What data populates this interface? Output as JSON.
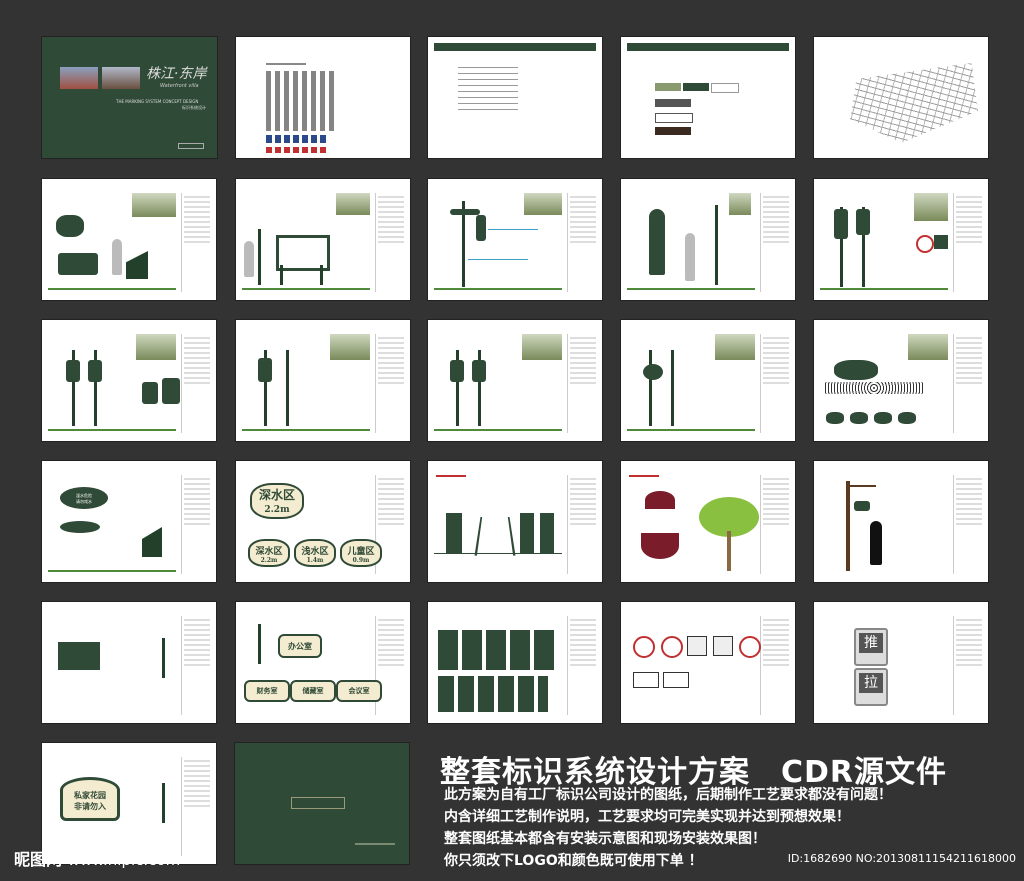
{
  "headline": "整套标识系统设计方案　CDR源文件",
  "description_lines": [
    "此方案为自有工厂标识公司设计的图纸，后期制作工艺要求都没有问题！",
    "内含详细工艺制作说明，工艺要求均可完美实现并达到预想效果！",
    "整套图纸基本都含有安装示意图和现场安装效果图！",
    "你只须改下LOGO和颜色既可使用下单 ！"
  ],
  "watermark": {
    "brand": "昵图网",
    "site": "www.nipic.com"
  },
  "image_id": "ID:1682690 NO:20130811154211618000",
  "cover": {
    "logo_script": "株江·东岸",
    "logo_sub": "Waterfront villa",
    "subtitle_en": "THE MARKING SYSTEM CONCEPT DESIGN",
    "subtitle_cn": "标识系统设计"
  },
  "signs": {
    "deep_water": "深水区",
    "deep_depth": "2.2m",
    "small": [
      "深水区",
      "浅水区",
      "儿童区"
    ],
    "small_depth": [
      "2.2m",
      "1.4m",
      "0.9m"
    ],
    "office": "办公室",
    "rooms": [
      "财务室",
      "储藏室",
      "会议室"
    ],
    "push": "推",
    "pull": "拉",
    "garden": [
      "私家花园",
      "非请勿入"
    ],
    "lake": [
      "湿水危险",
      "请勿戏水"
    ]
  },
  "colors": {
    "brand_green": "#2f4a36",
    "background": "#333333",
    "accent_red": "#7a1c2a"
  }
}
